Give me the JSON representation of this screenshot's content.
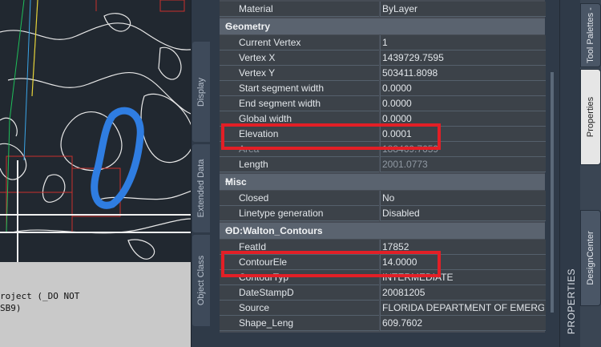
{
  "palette": {
    "title": "PROPERTIES",
    "side_tabs": [
      "Display",
      "Extended Data",
      "Object Class"
    ]
  },
  "right_tabs": [
    "Tool Palettes -",
    "Properties",
    "DesignCenter"
  ],
  "cad": {
    "command_text": "roject (_DO NOT\nSB9)"
  },
  "properties": {
    "top_row": {
      "key": "Material",
      "value": "ByLayer"
    },
    "geometry": {
      "title": "Geometry",
      "rows": [
        {
          "key": "Current Vertex",
          "value": "1"
        },
        {
          "key": "Vertex X",
          "value": "1439729.7595"
        },
        {
          "key": "Vertex Y",
          "value": "503411.8098"
        },
        {
          "key": "Start segment width",
          "value": "0.0000"
        },
        {
          "key": "End segment width",
          "value": "0.0000"
        },
        {
          "key": "Global width",
          "value": "0.0000"
        },
        {
          "key": "Elevation",
          "value": "0.0001"
        },
        {
          "key": "Area",
          "value": "188469.7659"
        },
        {
          "key": "Length",
          "value": "2001.0773"
        }
      ]
    },
    "misc": {
      "title": "Misc",
      "rows": [
        {
          "key": "Closed",
          "value": "No"
        },
        {
          "key": "Linetype generation",
          "value": "Disabled"
        }
      ]
    },
    "od": {
      "title": "OD:Walton_Contours",
      "rows": [
        {
          "key": "FeatId",
          "value": "17852"
        },
        {
          "key": "ContourEle",
          "value": "14.0000"
        },
        {
          "key": "ContourTyp",
          "value": "INTERMEDIATE"
        },
        {
          "key": "DateStampD",
          "value": "20081205"
        },
        {
          "key": "Source",
          "value": "FLORIDA DEPARTMENT OF EMERG..."
        },
        {
          "key": "Shape_Leng",
          "value": "609.7602"
        }
      ]
    },
    "collapse_symbol": "–"
  },
  "colors": {
    "highlight": "#e21f26",
    "selection": "#2f7de1"
  }
}
